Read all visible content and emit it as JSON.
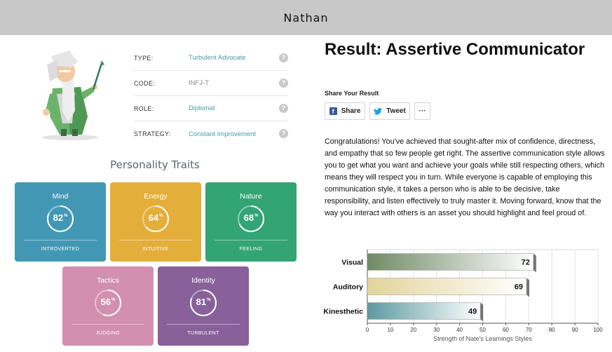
{
  "header": {
    "name": "Nathan"
  },
  "profile": {
    "rows": [
      {
        "label": "TYPE:",
        "value": "Turbulent Advocate"
      },
      {
        "label": "CODE:",
        "value": "INFJ-T"
      },
      {
        "label": "ROLE:",
        "value": "Diplomat"
      },
      {
        "label": "STRATEGY:",
        "value": "Constant Improvement"
      }
    ],
    "help_glyph": "?"
  },
  "traits": {
    "title": "Personality Traits",
    "items": [
      {
        "name": "Mind",
        "percent": "82",
        "unit": "%",
        "sub": "INTROVERTED",
        "color": "#4298b4"
      },
      {
        "name": "Energy",
        "percent": "64",
        "unit": "%",
        "sub": "INTUITIVE",
        "color": "#e4ae3a"
      },
      {
        "name": "Nature",
        "percent": "68",
        "unit": "%",
        "sub": "FEELING",
        "color": "#33a474"
      },
      {
        "name": "Tactics",
        "percent": "56",
        "unit": "%",
        "sub": "JUDGING",
        "color": "#d28fb0"
      },
      {
        "name": "Identity",
        "percent": "81",
        "unit": "%",
        "sub": "TURBULENT",
        "color": "#88619a"
      }
    ]
  },
  "result": {
    "title": "Result: Assertive Communicator",
    "share_label": "Share Your Result",
    "share_button": "Share",
    "tweet_button": "Tweet",
    "more_button": "···",
    "paragraph": "Congratulations! You've achieved that sought-after mix of confidence, directness, and empathy that so few people get right. The assertive communication style allows you to get what you want and achieve your goals while still respecting others, which means they will respect you in turn. While everyone is capable of employing this communication style, it takes a person who is able to be decisive, take responsibility, and listen effectively to truly master it. Moving forward, know that the way you interact with others is an asset you should highlight and feel proud of."
  },
  "chart_data": {
    "type": "bar",
    "orientation": "horizontal",
    "categories": [
      "Visual",
      "Auditory",
      "Kinesthetic"
    ],
    "values": [
      72,
      69,
      49
    ],
    "colors": [
      "#6f8a66",
      "#e3d49a",
      "#5b9aa0"
    ],
    "xlabel": "Strength of Nate's Learnings Styles",
    "xlim": [
      0,
      100
    ],
    "xticks": [
      0,
      10,
      20,
      30,
      40,
      50,
      60,
      70,
      80,
      90,
      100
    ],
    "grid": true
  }
}
